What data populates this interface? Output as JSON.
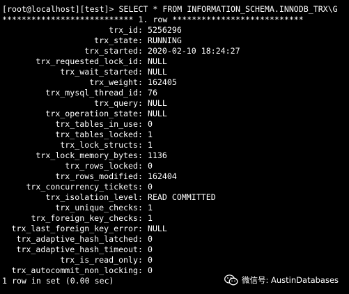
{
  "terminal": {
    "command_line": "[root@localhost][test]> SELECT * FROM INFORMATION_SCHEMA.INNODB_TRX\\G",
    "row_header": "*************************** 1. row ***************************",
    "fields": [
      {
        "name": "trx_id",
        "value": "5256296"
      },
      {
        "name": "trx_state",
        "value": "RUNNING"
      },
      {
        "name": "trx_started",
        "value": "2020-02-10 18:24:27"
      },
      {
        "name": "trx_requested_lock_id",
        "value": "NULL"
      },
      {
        "name": "trx_wait_started",
        "value": "NULL"
      },
      {
        "name": "trx_weight",
        "value": "162405"
      },
      {
        "name": "trx_mysql_thread_id",
        "value": "76"
      },
      {
        "name": "trx_query",
        "value": "NULL"
      },
      {
        "name": "trx_operation_state",
        "value": "NULL"
      },
      {
        "name": "trx_tables_in_use",
        "value": "0"
      },
      {
        "name": "trx_tables_locked",
        "value": "1"
      },
      {
        "name": "trx_lock_structs",
        "value": "1"
      },
      {
        "name": "trx_lock_memory_bytes",
        "value": "1136"
      },
      {
        "name": "trx_rows_locked",
        "value": "0"
      },
      {
        "name": "trx_rows_modified",
        "value": "162404"
      },
      {
        "name": "trx_concurrency_tickets",
        "value": "0"
      },
      {
        "name": "trx_isolation_level",
        "value": "READ COMMITTED"
      },
      {
        "name": "trx_unique_checks",
        "value": "1"
      },
      {
        "name": "trx_foreign_key_checks",
        "value": "1"
      },
      {
        "name": "trx_last_foreign_key_error",
        "value": "NULL"
      },
      {
        "name": "trx_adaptive_hash_latched",
        "value": "0"
      },
      {
        "name": "trx_adaptive_hash_timeout",
        "value": "0"
      },
      {
        "name": "trx_is_read_only",
        "value": "0"
      },
      {
        "name": "trx_autocommit_non_locking",
        "value": "0"
      }
    ],
    "footer": "1 row in set (0.00 sec)"
  },
  "watermark": {
    "icon": "wechat-icon",
    "text": "微信号: AustinDatabases"
  },
  "colors": {
    "background": "#000000",
    "foreground": "#ffffff"
  }
}
